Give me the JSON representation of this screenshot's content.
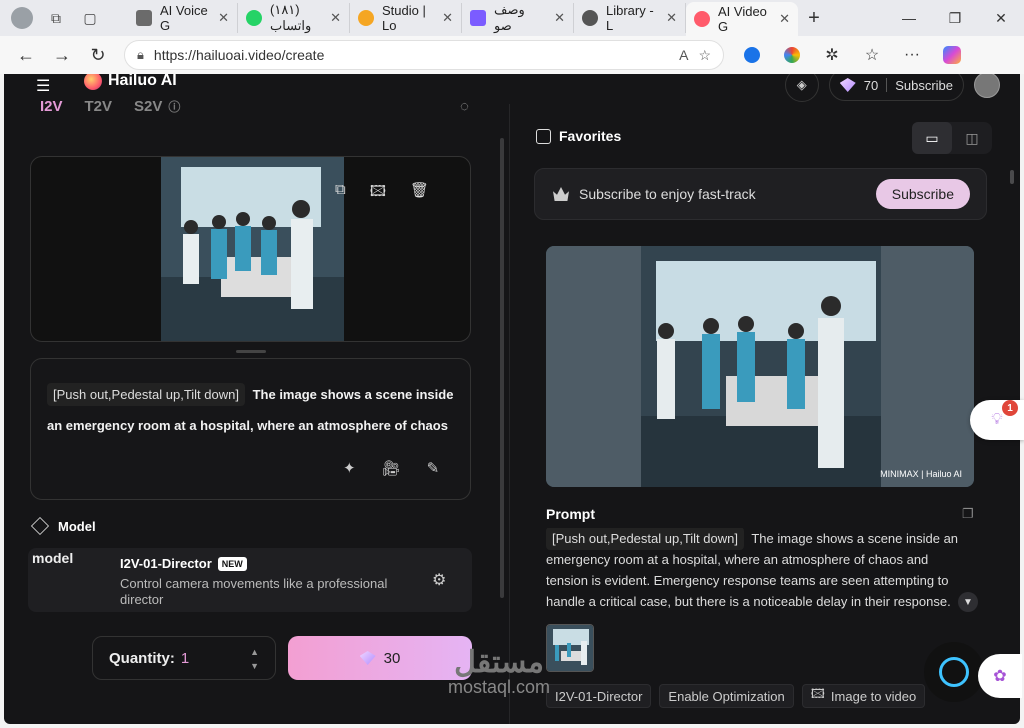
{
  "browser": {
    "tabs": [
      {
        "label": "AI Voice G",
        "color": "#6b6b6b"
      },
      {
        "label": "(١٨١) واتساب",
        "color": "#25d366"
      },
      {
        "label": "Studio | Lo",
        "color": "#f5a623"
      },
      {
        "label": "وصف صو",
        "color": "#7b5cff"
      },
      {
        "label": "Library - L",
        "color": "#555555"
      },
      {
        "label": "AI Video G",
        "color": "#ff5b6b"
      }
    ],
    "url": "https://hailuoai.video/create"
  },
  "header": {
    "brand": "Hailuo AI",
    "credits": "70",
    "subscribe_label": "Subscribe"
  },
  "left": {
    "mode_tabs": [
      "I2V",
      "T2V",
      "S2V"
    ],
    "active_mode": "I2V",
    "prompt": {
      "camera_tag": "[Push out,Pedestal up,Tilt down]",
      "text": "The image shows a scene inside an emergency room at a hospital, where an atmosphere of chaos and tension is evident."
    },
    "model_section_label": "Model",
    "model": {
      "image_alt": "model",
      "name": "I2V-01-Director",
      "badge": "NEW",
      "description": "Control camera movements like a professional director"
    },
    "quantity_label": "Quantity:",
    "quantity_value": "1",
    "generate_cost": "30"
  },
  "right": {
    "favorites_label": "Favorites",
    "subscribe_bar_text": "Subscribe to enjoy fast-track",
    "subscribe_button": "Subscribe",
    "prompt_heading": "Prompt",
    "result_camera_tag": "[Push out,Pedestal up,Tilt down]",
    "result_text": "The image shows a scene inside an emergency room at a hospital, where an atmosphere of chaos and tension is evident. Emergency response teams are seen attempting to handle a critical case, but there is a noticeable delay in their response.",
    "image_watermark": "MINIMAX | Hailuo AI",
    "chips": [
      "I2V-01-Director",
      "Enable Optimization",
      "Image to video"
    ]
  },
  "overlay": {
    "notification_count": "1",
    "watermark_ar": "مستقل",
    "watermark_en": "mostaql.com"
  }
}
